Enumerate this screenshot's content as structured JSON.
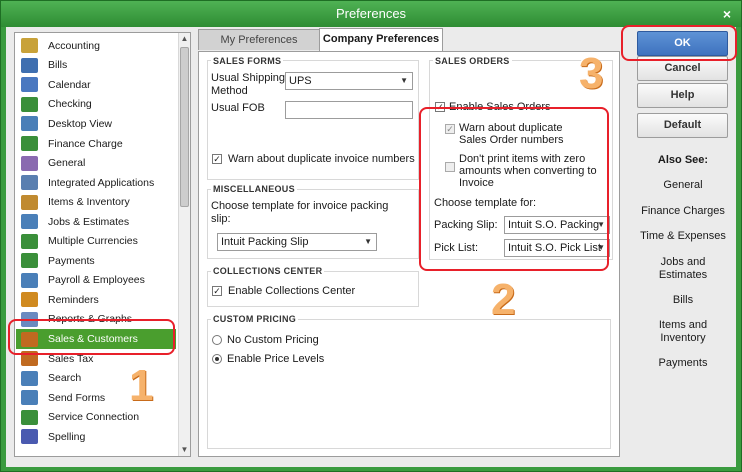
{
  "window": {
    "title": "Preferences",
    "close": "×"
  },
  "sidebar": {
    "items": [
      {
        "label": "Accounting",
        "icon": "accounting-icon",
        "color": "#c8a23a"
      },
      {
        "label": "Bills",
        "icon": "bills-icon",
        "color": "#3f6fb0"
      },
      {
        "label": "Calendar",
        "icon": "calendar-icon",
        "color": "#4a78c0"
      },
      {
        "label": "Checking",
        "icon": "checking-icon",
        "color": "#3a8f3a"
      },
      {
        "label": "Desktop View",
        "icon": "desktop-view-icon",
        "color": "#4a7fb8"
      },
      {
        "label": "Finance Charge",
        "icon": "finance-charge-icon",
        "color": "#3a8f3a"
      },
      {
        "label": "General",
        "icon": "general-icon",
        "color": "#8a6ab0"
      },
      {
        "label": "Integrated Applications",
        "icon": "integrated-apps-icon",
        "color": "#5a7fb0"
      },
      {
        "label": "Items & Inventory",
        "icon": "items-inventory-icon",
        "color": "#c08a30"
      },
      {
        "label": "Jobs & Estimates",
        "icon": "jobs-estimates-icon",
        "color": "#4a7fb8"
      },
      {
        "label": "Multiple Currencies",
        "icon": "currencies-icon",
        "color": "#3a8f3a"
      },
      {
        "label": "Payments",
        "icon": "payments-icon",
        "color": "#3a8f3a"
      },
      {
        "label": "Payroll & Employees",
        "icon": "payroll-icon",
        "color": "#4a7fb8"
      },
      {
        "label": "Reminders",
        "icon": "reminders-icon",
        "color": "#d08a20"
      },
      {
        "label": "Reports & Graphs",
        "icon": "reports-icon",
        "color": "#6a8ac0"
      },
      {
        "label": "Sales & Customers",
        "icon": "sales-customers-icon",
        "color": "#c06a20"
      },
      {
        "label": "Sales Tax",
        "icon": "sales-tax-icon",
        "color": "#c06a20"
      },
      {
        "label": "Search",
        "icon": "search-icon",
        "color": "#4a7fb8"
      },
      {
        "label": "Send Forms",
        "icon": "send-forms-icon",
        "color": "#4a7fb8"
      },
      {
        "label": "Service Connection",
        "icon": "service-connection-icon",
        "color": "#3a8f3a"
      },
      {
        "label": "Spelling",
        "icon": "spelling-icon",
        "color": "#4a5ab0"
      }
    ],
    "selected_index": 15,
    "scroll_up": "▲",
    "scroll_down": "▼"
  },
  "tabs": {
    "my": "My Preferences",
    "company": "Company Preferences"
  },
  "sales_forms": {
    "title": "SALES FORMS",
    "shipping_label_1": "Usual Shipping",
    "shipping_label_2": "Method",
    "shipping_value": "UPS",
    "fob_label": "Usual FOB",
    "fob_value": "",
    "warn_dup_invoice": "Warn about duplicate invoice numbers"
  },
  "misc": {
    "title": "MISCELLANEOUS",
    "choose_1": "Choose template for invoice packing",
    "choose_2": "slip:",
    "template_value": "Intuit Packing Slip"
  },
  "collections": {
    "title": "COLLECTIONS CENTER",
    "enable": "Enable Collections Center"
  },
  "custom_pricing": {
    "title": "CUSTOM PRICING",
    "none": "No Custom Pricing",
    "levels": "Enable Price Levels"
  },
  "sales_orders": {
    "title": "SALES ORDERS",
    "enable": "Enable Sales Orders",
    "warn_1": "Warn about duplicate",
    "warn_2": "Sales Order numbers",
    "noprint_1": "Don't print items with zero",
    "noprint_2": "amounts when converting to",
    "noprint_3": "Invoice",
    "choose": "Choose template for:",
    "packing_label": "Packing Slip:",
    "packing_value": "Intuit S.O. Packing",
    "pick_label": "Pick List:",
    "pick_value": "Intuit S.O. Pick List"
  },
  "buttons": {
    "ok": "OK",
    "cancel": "Cancel",
    "help": "Help",
    "default": "Default"
  },
  "also_see": {
    "title": "Also See:",
    "links": [
      "General",
      "Finance Charges",
      "Time & Expenses",
      "Jobs and\nEstimates",
      "Bills",
      "Items and\nInventory",
      "Payments"
    ]
  },
  "annotations": {
    "one": "1",
    "two": "2",
    "three": "3",
    "color": "#e8202a"
  }
}
